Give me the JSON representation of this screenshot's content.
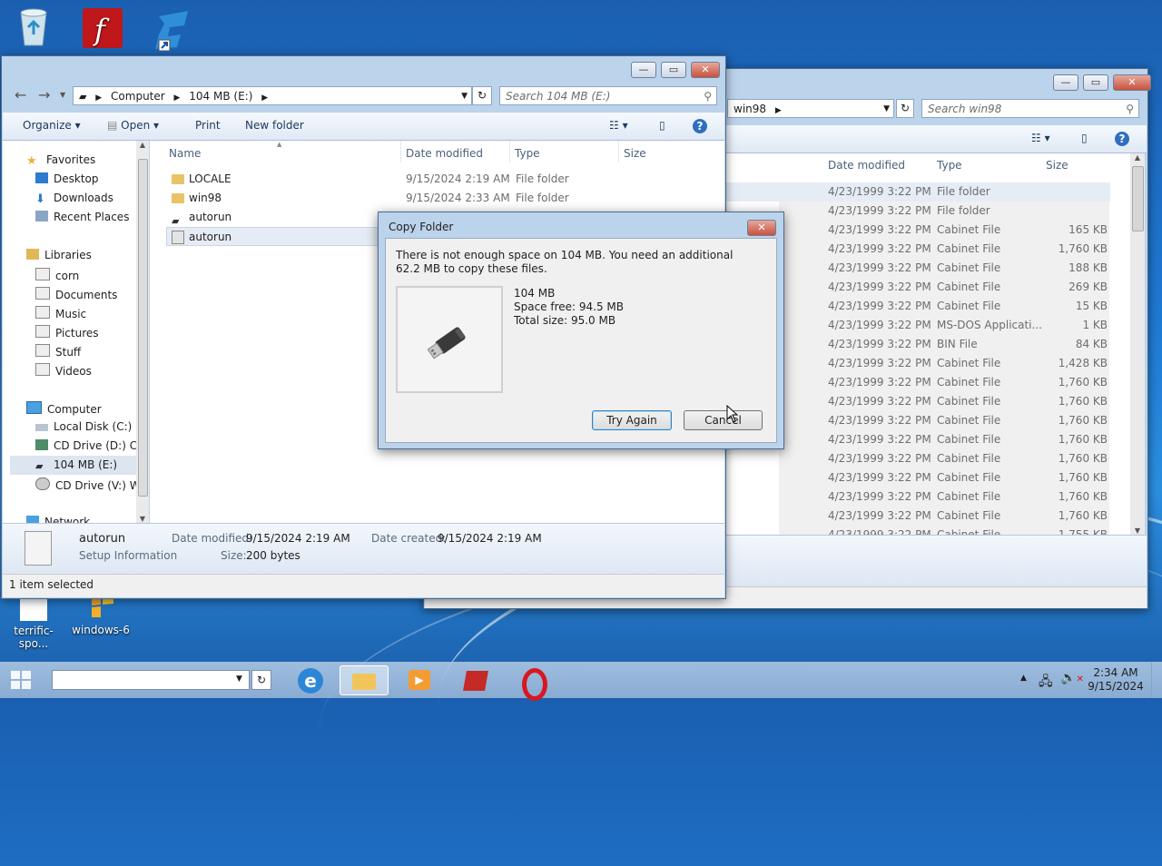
{
  "desktop": {
    "icons_bottom": [
      "terrific-spo...",
      "windows-6"
    ]
  },
  "back_window": {
    "address_tail": "win98",
    "search_placeholder": "Search win98",
    "columns": {
      "date": "Date modified",
      "type": "Type",
      "size": "Size"
    },
    "rows": [
      {
        "date": "4/23/1999 3:22 PM",
        "type": "File folder",
        "size": ""
      },
      {
        "date": "4/23/1999 3:22 PM",
        "type": "File folder",
        "size": ""
      },
      {
        "date": "4/23/1999 3:22 PM",
        "type": "Cabinet File",
        "size": "165 KB"
      },
      {
        "date": "4/23/1999 3:22 PM",
        "type": "Cabinet File",
        "size": "1,760 KB"
      },
      {
        "date": "4/23/1999 3:22 PM",
        "type": "Cabinet File",
        "size": "188 KB"
      },
      {
        "date": "4/23/1999 3:22 PM",
        "type": "Cabinet File",
        "size": "269 KB"
      },
      {
        "date": "4/23/1999 3:22 PM",
        "type": "Cabinet File",
        "size": "15 KB"
      },
      {
        "date": "4/23/1999 3:22 PM",
        "type": "MS-DOS Applicati...",
        "size": "1 KB"
      },
      {
        "date": "4/23/1999 3:22 PM",
        "type": "BIN File",
        "size": "84 KB"
      },
      {
        "date": "4/23/1999 3:22 PM",
        "type": "Cabinet File",
        "size": "1,428 KB"
      },
      {
        "date": "4/23/1999 3:22 PM",
        "type": "Cabinet File",
        "size": "1,760 KB"
      },
      {
        "date": "4/23/1999 3:22 PM",
        "type": "Cabinet File",
        "size": "1,760 KB"
      },
      {
        "date": "4/23/1999 3:22 PM",
        "type": "Cabinet File",
        "size": "1,760 KB"
      },
      {
        "date": "4/23/1999 3:22 PM",
        "type": "Cabinet File",
        "size": "1,760 KB"
      },
      {
        "date": "4/23/1999 3:22 PM",
        "type": "Cabinet File",
        "size": "1,760 KB"
      },
      {
        "date": "4/23/1999 3:22 PM",
        "type": "Cabinet File",
        "size": "1,760 KB"
      },
      {
        "date": "4/23/1999 3:22 PM",
        "type": "Cabinet File",
        "size": "1,760 KB"
      },
      {
        "date": "4/23/1999 3:22 PM",
        "type": "Cabinet File",
        "size": "1,760 KB"
      },
      {
        "date": "4/23/1999 3:22 PM",
        "type": "Cabinet File",
        "size": "1,755 KB"
      }
    ]
  },
  "front_window": {
    "breadcrumb": [
      "Computer",
      "104 MB (E:)"
    ],
    "search_placeholder": "Search 104 MB (E:)",
    "toolbar": {
      "organize": "Organize",
      "open": "Open",
      "print": "Print",
      "new_folder": "New folder"
    },
    "nav": {
      "favorites": "Favorites",
      "fav_items": [
        "Desktop",
        "Downloads",
        "Recent Places"
      ],
      "libraries": "Libraries",
      "lib_items": [
        "corn",
        "Documents",
        "Music",
        "Pictures",
        "Stuff",
        "Videos"
      ],
      "computer": "Computer",
      "comp_items": [
        "Local Disk (C:)",
        "CD Drive (D:) CCC",
        "104 MB (E:)",
        "CD Drive (V:) Win"
      ],
      "network": "Network"
    },
    "columns": {
      "name": "Name",
      "date": "Date modified",
      "type": "Type",
      "size": "Size"
    },
    "files": [
      {
        "name": "LOCALE",
        "date": "9/15/2024 2:19 AM",
        "type": "File folder"
      },
      {
        "name": "win98",
        "date": "9/15/2024 2:33 AM",
        "type": "File folder"
      },
      {
        "name": "autorun",
        "date": "",
        "type": ""
      },
      {
        "name": "autorun",
        "date": "",
        "type": ""
      }
    ],
    "details": {
      "name": "autorun",
      "kind": "Setup Information",
      "modified_label": "Date modified:",
      "modified": "9/15/2024 2:19 AM",
      "size_label": "Size:",
      "size": "200 bytes",
      "created_label": "Date created:",
      "created": "9/15/2024 2:19 AM"
    },
    "status": "1 item selected"
  },
  "dialog": {
    "title": "Copy Folder",
    "message": "There is not enough space on 104 MB. You need an additional 62.2 MB to copy these files.",
    "drive_name": "104 MB",
    "space_free": "Space free: 94.5 MB",
    "total_size": "Total size: 95.0 MB",
    "try_again": "Try Again",
    "cancel": "Cancel"
  },
  "taskbar": {
    "time": "2:34 AM",
    "date": "9/15/2024"
  }
}
